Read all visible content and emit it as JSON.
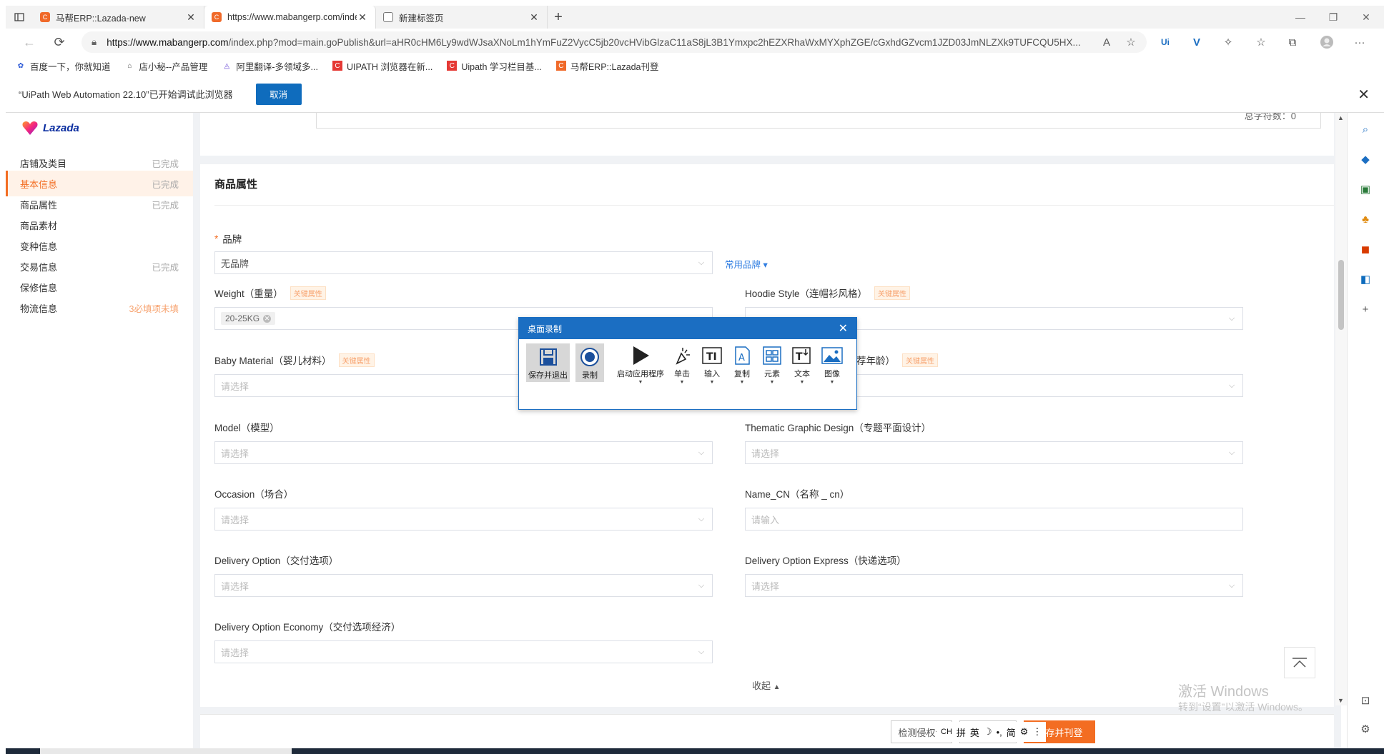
{
  "browser": {
    "tabs": [
      {
        "title": "马帮ERP::Lazada-new",
        "active": false
      },
      {
        "title": "https://www.mabangerp.com/index.php?mod=main.goPublish",
        "active": true
      },
      {
        "title": "新建标签页",
        "active": false
      }
    ],
    "url_host": "https://www.mabangerp.com",
    "url_rest": "/index.php?mod=main.goPublish&url=aHR0cHM6Ly9wdWJsaXNoLm1hYmFuZ2VycC5jb20vcHVibGlzaC11aS8jL3B1Ymxpc2hEZXRhaWxMYXphZGE/cGxhdGZvcm1JZD03JmNLZXk9TUFCQU5HX..."
  },
  "bookmarks": [
    {
      "label": "百度一下，你就知道",
      "icon": "paw-icon"
    },
    {
      "label": "店小秘--产品管理",
      "icon": "shop-icon"
    },
    {
      "label": "阿里翻译-多领域多...",
      "icon": "translate-icon"
    },
    {
      "label": "UIPATH 浏览器在新...",
      "icon": "c-logo-icon"
    },
    {
      "label": "Uipath 学习栏目基...",
      "icon": "c-logo-icon"
    },
    {
      "label": "马帮ERP::Lazada刊登",
      "icon": "mabang-icon"
    }
  ],
  "infobar": {
    "message": "“UiPath Web Automation 22.10”已开始调试此浏览器",
    "cancel": "取消"
  },
  "sidebar": {
    "logo": "Lazada",
    "items": [
      {
        "label": "店铺及类目",
        "status": "已完成"
      },
      {
        "label": "基本信息",
        "status": "已完成"
      },
      {
        "label": "商品属性",
        "status": "已完成"
      },
      {
        "label": "商品素材",
        "status": ""
      },
      {
        "label": "变种信息",
        "status": ""
      },
      {
        "label": "交易信息",
        "status": "已完成"
      },
      {
        "label": "保修信息",
        "status": ""
      },
      {
        "label": "物流信息",
        "status": "3必填项未填"
      }
    ]
  },
  "topcard": {
    "count": "总字符数：0"
  },
  "attributes": {
    "title": "商品属性",
    "key_tag": "关键属性",
    "brand": {
      "label": "品牌",
      "value": "无品牌",
      "common": "常用品牌"
    },
    "weight": {
      "label": "Weight（重量）",
      "chip": "20-25KG"
    },
    "hoodie": {
      "label": "Hoodie Style（连帽衫风格）"
    },
    "baby_material": {
      "label": "Baby Material（婴儿材料）",
      "placeholder": "请选择"
    },
    "age_partial": {
      "label": "荐年龄）"
    },
    "model": {
      "label": "Model（模型）",
      "placeholder": "请选择"
    },
    "thematic": {
      "label": "Thematic Graphic Design（专题平面设计）",
      "placeholder": "请选择"
    },
    "occasion": {
      "label": "Occasion（场合）",
      "placeholder": "请选择"
    },
    "name_cn": {
      "label": "Name_CN（名称 _ cn）",
      "placeholder": "请输入"
    },
    "delivery": {
      "label": "Delivery Option（交付选项）",
      "placeholder": "请选择"
    },
    "delivery_express": {
      "label": "Delivery Option Express（快递选项）",
      "placeholder": "请选择"
    },
    "delivery_economy": {
      "label": "Delivery Option Economy（交付选项经济）",
      "placeholder": "请选择"
    },
    "collapse": "收起"
  },
  "footer": {
    "check": "检测侵权词",
    "save_publish": "保存并刊登"
  },
  "ime": [
    "CH",
    "拼",
    "英",
    "简"
  ],
  "watermark": {
    "line1": "激活 Windows",
    "line2": "转到“设置”以激活 Windows。"
  },
  "recorder": {
    "title": "桌面录制",
    "tools": [
      {
        "label": "保存并退出",
        "icon": "floppy-save-icon"
      },
      {
        "label": "录制",
        "icon": "record-icon"
      },
      {
        "label": "启动应用程序",
        "icon": "play-icon"
      },
      {
        "label": "单击",
        "icon": "click-icon"
      },
      {
        "label": "输入",
        "icon": "type-into-icon"
      },
      {
        "label": "复制",
        "icon": "copy-text-icon"
      },
      {
        "label": "元素",
        "icon": "element-icon"
      },
      {
        "label": "文本",
        "icon": "text-icon"
      },
      {
        "label": "图像",
        "icon": "image-icon"
      }
    ]
  }
}
